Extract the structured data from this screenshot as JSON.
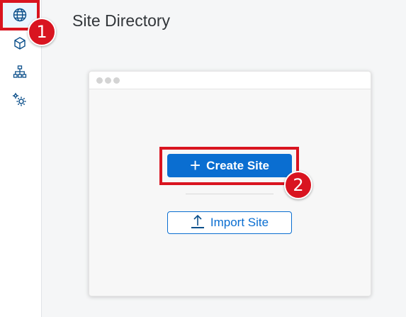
{
  "page": {
    "title": "Site Directory"
  },
  "sidebar": {
    "items": [
      {
        "icon": "globe-icon",
        "selected": true
      },
      {
        "icon": "cube-icon",
        "selected": false
      },
      {
        "icon": "hierarchy-icon",
        "selected": false
      },
      {
        "icon": "gears-icon",
        "selected": false
      }
    ]
  },
  "actions": {
    "create_label": "Create Site",
    "create_icon": "plus-icon",
    "import_label": "Import Site",
    "import_icon": "upload-icon"
  },
  "annotations": {
    "step1": "1",
    "step2": "2"
  },
  "colors": {
    "accent": "#0a6ed1",
    "highlight": "#d91420",
    "icon": "#0b4f8a"
  }
}
